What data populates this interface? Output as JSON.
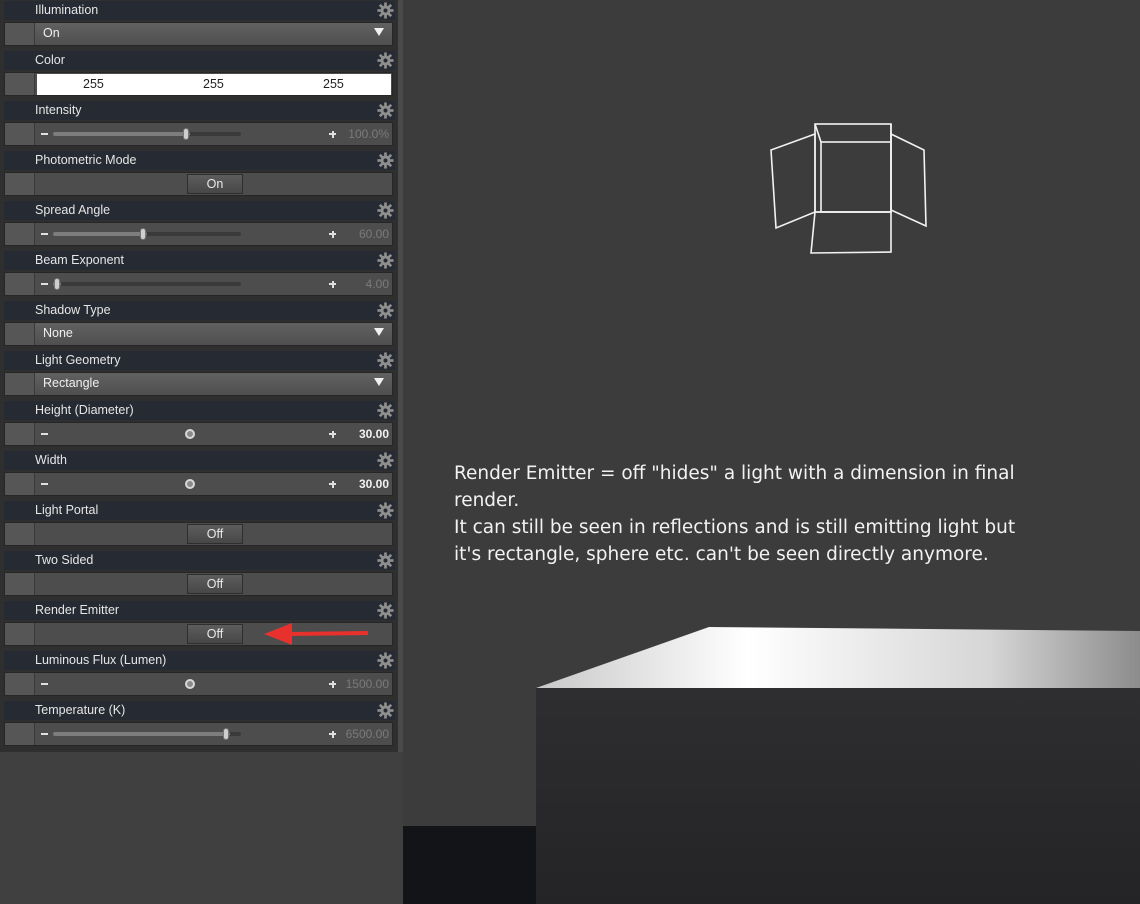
{
  "panel": {
    "properties": [
      {
        "label": "Illumination",
        "kind": "dropdown",
        "value": "On"
      },
      {
        "label": "Color",
        "kind": "color",
        "r": "255",
        "g": "255",
        "b": "255"
      },
      {
        "label": "Intensity",
        "kind": "slider",
        "value": "100.0%",
        "fraction": 0.73,
        "bold": false
      },
      {
        "label": "Photometric Mode",
        "kind": "toggle",
        "value": "On"
      },
      {
        "label": "Spread Angle",
        "kind": "slider",
        "value": "60.00",
        "fraction": 0.5,
        "bold": false
      },
      {
        "label": "Beam Exponent",
        "kind": "slider",
        "value": "4.00",
        "fraction": 0.04,
        "bold": false
      },
      {
        "label": "Shadow Type",
        "kind": "dropdown",
        "value": "None"
      },
      {
        "label": "Light Geometry",
        "kind": "dropdown",
        "value": "Rectangle"
      },
      {
        "label": "Height (Diameter)",
        "kind": "dial",
        "value": "30.00",
        "bold": true
      },
      {
        "label": "Width",
        "kind": "dial",
        "value": "30.00",
        "bold": true
      },
      {
        "label": "Light Portal",
        "kind": "toggle",
        "value": "Off"
      },
      {
        "label": "Two Sided",
        "kind": "toggle",
        "value": "Off"
      },
      {
        "label": "Render Emitter",
        "kind": "toggle",
        "value": "Off"
      },
      {
        "label": "Luminous Flux (Lumen)",
        "kind": "dial",
        "value": "1500.00",
        "bold": false
      },
      {
        "label": "Temperature (K)",
        "kind": "slider",
        "value": "6500.00",
        "fraction": 0.94,
        "bold": false
      }
    ]
  },
  "annotation": {
    "arrow_color": "#e8302c",
    "lines": [
      "Render Emitter = off \"hides\" a light with a dimension in final",
      "render.",
      "It can still be seen in reflections and is still emitting light but",
      "it's rectangle, sphere etc. can't be seen directly anymore."
    ]
  },
  "icons": {
    "property_settings": "gear-icon",
    "dropdown_open": "triangle-down-icon",
    "decrement": "minus-icon",
    "increment": "plus-icon"
  }
}
